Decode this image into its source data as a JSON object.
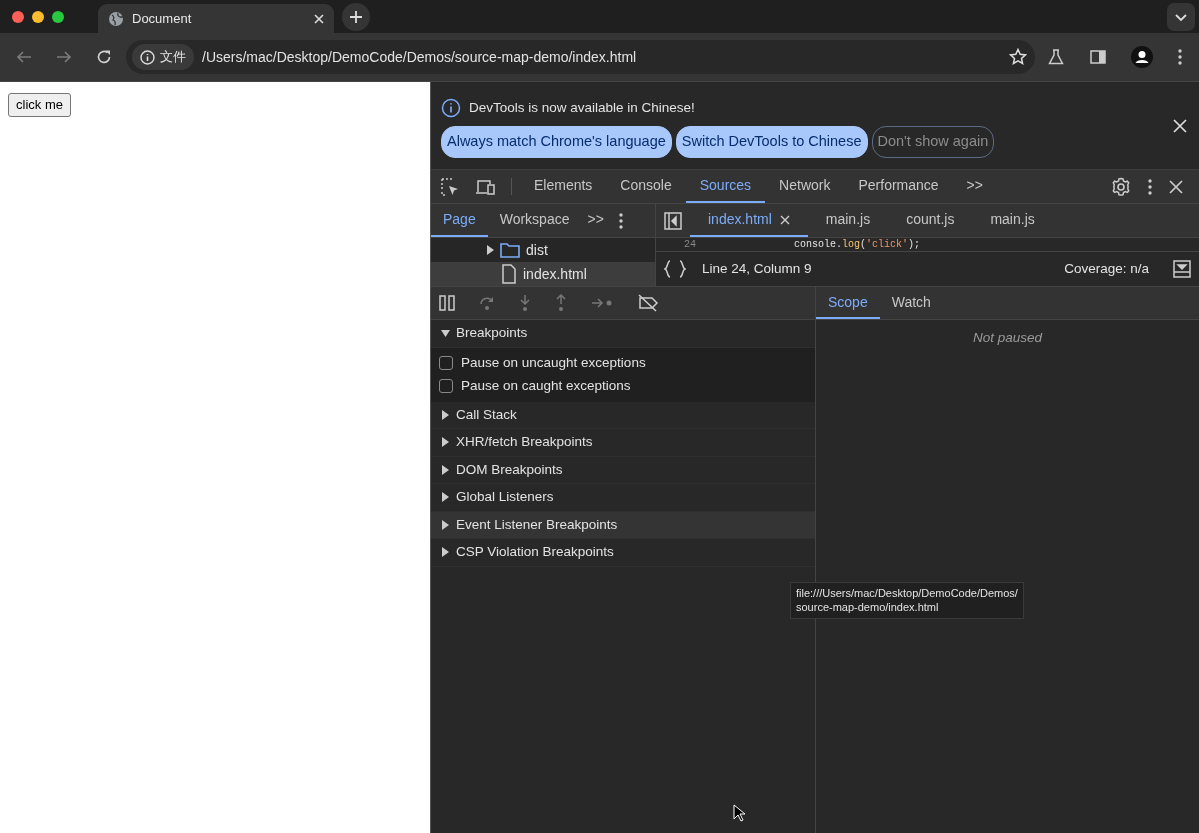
{
  "browser": {
    "tab_title": "Document",
    "address_chip": "文件",
    "url": "/Users/mac/Desktop/DemoCode/Demos/source-map-demo/index.html"
  },
  "page": {
    "button": "click me"
  },
  "devtools": {
    "infobar": {
      "message": "DevTools is now available in Chinese!",
      "buttons": [
        {
          "label": "Always match Chrome's language",
          "kind": "primary"
        },
        {
          "label": "Switch DevTools to Chinese",
          "kind": "primary"
        },
        {
          "label": "Don't show again",
          "kind": "outline"
        }
      ]
    },
    "tabs": [
      {
        "label": "Elements",
        "selected": false
      },
      {
        "label": "Console",
        "selected": false
      },
      {
        "label": "Sources",
        "selected": true
      },
      {
        "label": "Network",
        "selected": false
      },
      {
        "label": "Performance",
        "selected": false
      }
    ],
    "overflow": ">>",
    "navigator": {
      "tabs": [
        {
          "label": "Page",
          "selected": true
        },
        {
          "label": "Workspace",
          "selected": false
        }
      ],
      "overflow": ">>",
      "tree": [
        {
          "label": "dist",
          "kind": "folder",
          "expanded": false,
          "selected": false
        },
        {
          "label": "index.html",
          "kind": "file",
          "selected": true
        }
      ]
    },
    "editor_tabs": [
      {
        "label": "index.html",
        "selected": true,
        "closable": true
      },
      {
        "label": "main.js",
        "selected": false,
        "closable": false
      },
      {
        "label": "count.js",
        "selected": false,
        "closable": false
      },
      {
        "label": "main.js",
        "selected": false,
        "closable": false
      }
    ],
    "code": {
      "line_number": "24",
      "tokens": [
        {
          "text": "console.",
          "kind": "plain"
        },
        {
          "text": "log",
          "kind": "method"
        },
        {
          "text": "(",
          "kind": "plain"
        },
        {
          "text": "'click'",
          "kind": "string"
        },
        {
          "text": ");",
          "kind": "plain"
        }
      ]
    },
    "status": {
      "position": "Line 24, Column 9",
      "coverage": "Coverage: n/a"
    },
    "sections": [
      {
        "title": "Breakpoints",
        "expanded": true,
        "hovered": false,
        "options": [
          {
            "label": "Pause on uncaught exceptions",
            "checked": false
          },
          {
            "label": "Pause on caught exceptions",
            "checked": false
          }
        ]
      },
      {
        "title": "Call Stack",
        "expanded": false,
        "hovered": false
      },
      {
        "title": "XHR/fetch Breakpoints",
        "expanded": false,
        "hovered": false
      },
      {
        "title": "DOM Breakpoints",
        "expanded": false,
        "hovered": false
      },
      {
        "title": "Global Listeners",
        "expanded": false,
        "hovered": false
      },
      {
        "title": "Event Listener Breakpoints",
        "expanded": false,
        "hovered": true
      },
      {
        "title": "CSP Violation Breakpoints",
        "expanded": false,
        "hovered": false
      }
    ],
    "side_tabs": [
      {
        "label": "Scope",
        "selected": true
      },
      {
        "label": "Watch",
        "selected": false
      }
    ],
    "scope_message": "Not paused",
    "tooltip": [
      "file:///Users/mac/Desktop/DemoCode/Demos/",
      "source-map-demo/index.html"
    ]
  }
}
